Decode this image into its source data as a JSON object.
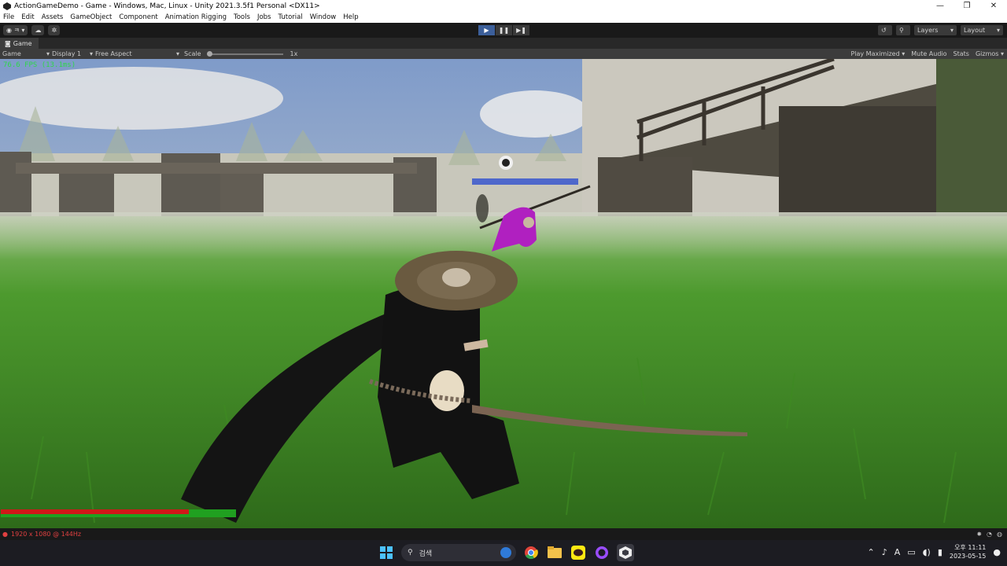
{
  "window": {
    "title": "ActionGameDemo - Game - Windows, Mac, Linux - Unity 2021.3.5f1 Personal <DX11>",
    "minimize": "—",
    "maximize": "❐",
    "close": "✕"
  },
  "menu": [
    "File",
    "Edit",
    "Assets",
    "GameObject",
    "Component",
    "Animation Rigging",
    "Tools",
    "Jobs",
    "Tutorial",
    "Window",
    "Help"
  ],
  "toolbar": {
    "account_label": "ㅋ ▾",
    "layers_label": "Layers",
    "layout_label": "Layout"
  },
  "tab": {
    "label": "Game"
  },
  "gamebar": {
    "mode": "Game",
    "display": "Display 1",
    "aspect": "Free Aspect",
    "scale_label": "Scale",
    "scale_value": "1x",
    "play_maximized": "Play Maximized",
    "mute_audio": "Mute Audio",
    "stats": "Stats",
    "gizmos": "Gizmos"
  },
  "viewport": {
    "fps": "76.6 FPS (13.1ms)",
    "health_fraction": 0.8
  },
  "status": {
    "text": "1920 x 1080 @ 144Hz"
  },
  "taskbar": {
    "search_placeholder": "검색",
    "time": "오후 11:11",
    "date": "2023-05-15"
  },
  "colors": {
    "unity_accent": "#3c5f9a",
    "health_red": "#d01818",
    "health_green": "#20a020",
    "fps_green": "#2fd64a"
  }
}
